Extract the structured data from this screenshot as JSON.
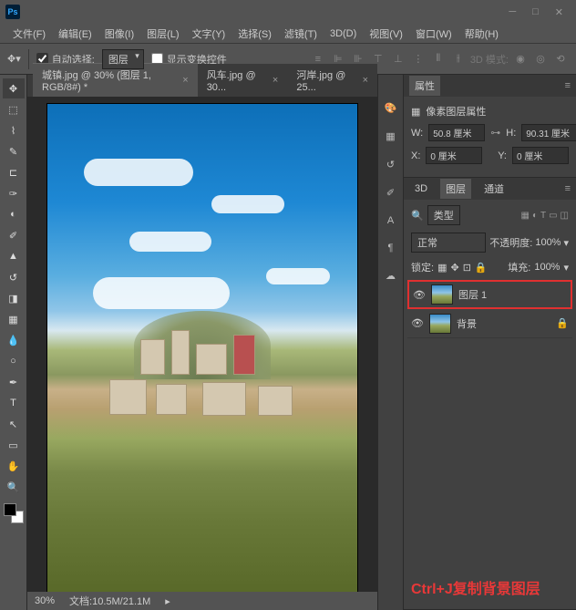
{
  "menus": [
    "文件(F)",
    "编辑(E)",
    "图像(I)",
    "图层(L)",
    "文字(Y)",
    "选择(S)",
    "滤镜(T)",
    "3D(D)",
    "视图(V)",
    "窗口(W)",
    "帮助(H)"
  ],
  "optbar": {
    "auto_select": "自动选择:",
    "target": "图层",
    "show_transform": "显示变换控件",
    "mode_3d": "3D 模式:"
  },
  "tabs": [
    {
      "label": "城镇.jpg @ 30% (图层 1, RGB/8#) *",
      "active": true
    },
    {
      "label": "风车.jpg @ 30...",
      "active": false
    },
    {
      "label": "河岸.jpg @ 25...",
      "active": false
    }
  ],
  "status": {
    "zoom": "30%",
    "doc": "文档:10.5M/21.1M"
  },
  "properties": {
    "tab": "属性",
    "title": "像素图层属性",
    "w_label": "W:",
    "w": "50.8 厘米",
    "h_label": "H:",
    "h": "90.31 厘米",
    "x_label": "X:",
    "x": "0 厘米",
    "y_label": "Y:",
    "y": "0 厘米"
  },
  "layers_panel": {
    "tabs": [
      "3D",
      "图层",
      "通道"
    ],
    "kind": "类型",
    "blend": "正常",
    "opacity_label": "不透明度:",
    "opacity": "100%",
    "lock_label": "锁定:",
    "fill_label": "填充:",
    "fill": "100%",
    "layers": [
      {
        "name": "图层 1",
        "selected": true,
        "locked": false
      },
      {
        "name": "背景",
        "selected": false,
        "locked": true
      }
    ]
  },
  "annotation": "Ctrl+J复制背景图层"
}
